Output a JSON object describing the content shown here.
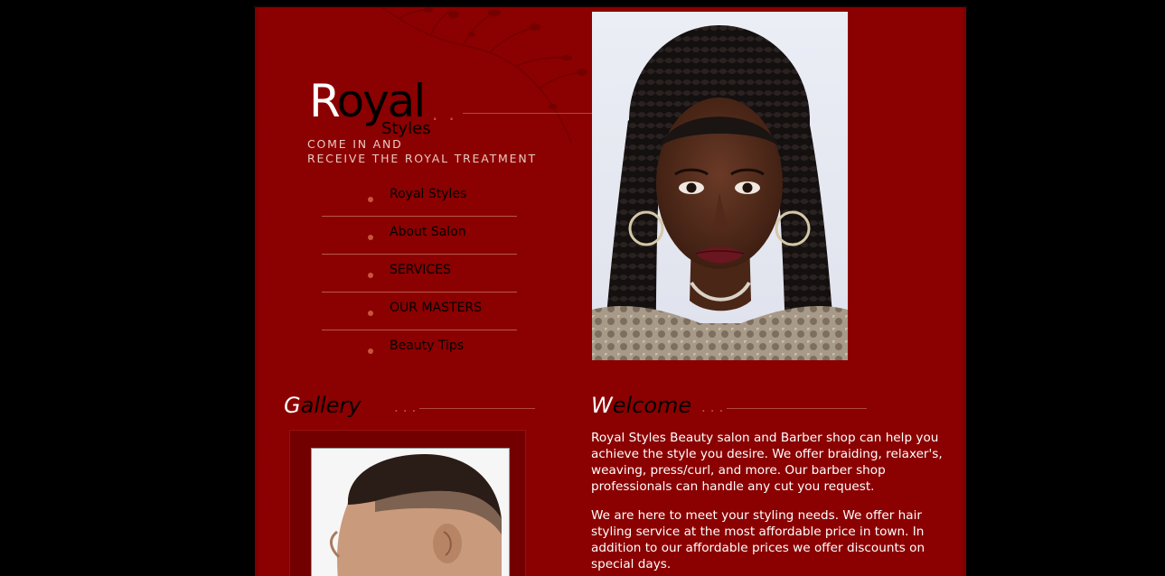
{
  "colors": {
    "outer_background": "#000000",
    "page_background": "#8b0000",
    "accent_dots": "#c8553d",
    "body_text": "#ffffff",
    "nav_text": "#000000"
  },
  "logo": {
    "initial": "R",
    "rest": "oyal",
    "dots": "..",
    "subtitle": "Styles"
  },
  "tagline": {
    "line1": "COME IN AND",
    "line2": "RECEIVE THE ROYAL TREATMENT"
  },
  "nav": {
    "items": [
      {
        "label": "Royal Styles"
      },
      {
        "label": "About Salon"
      },
      {
        "label": "SERVICES"
      },
      {
        "label": "OUR MASTERS"
      },
      {
        "label": "Beauty Tips"
      }
    ]
  },
  "hero": {
    "icon": "portrait-photo-braids"
  },
  "gallery": {
    "title_initial": "G",
    "title_rest": "allery",
    "dots": "...",
    "thumbnail_icon": "haircut-photo"
  },
  "welcome": {
    "title_initial": "W",
    "title_rest": "elcome",
    "dots": "...",
    "paragraphs": [
      "Royal Styles Beauty salon and Barber shop can help you achieve the style you desire. We offer braiding, relaxer's, weaving, press/curl, and more. Our barber shop professionals can handle any cut you request.",
      "We are here to meet your styling needs. We offer hair styling service at the most affordable price in town. In addition to our affordable prices we offer discounts on special days."
    ]
  }
}
